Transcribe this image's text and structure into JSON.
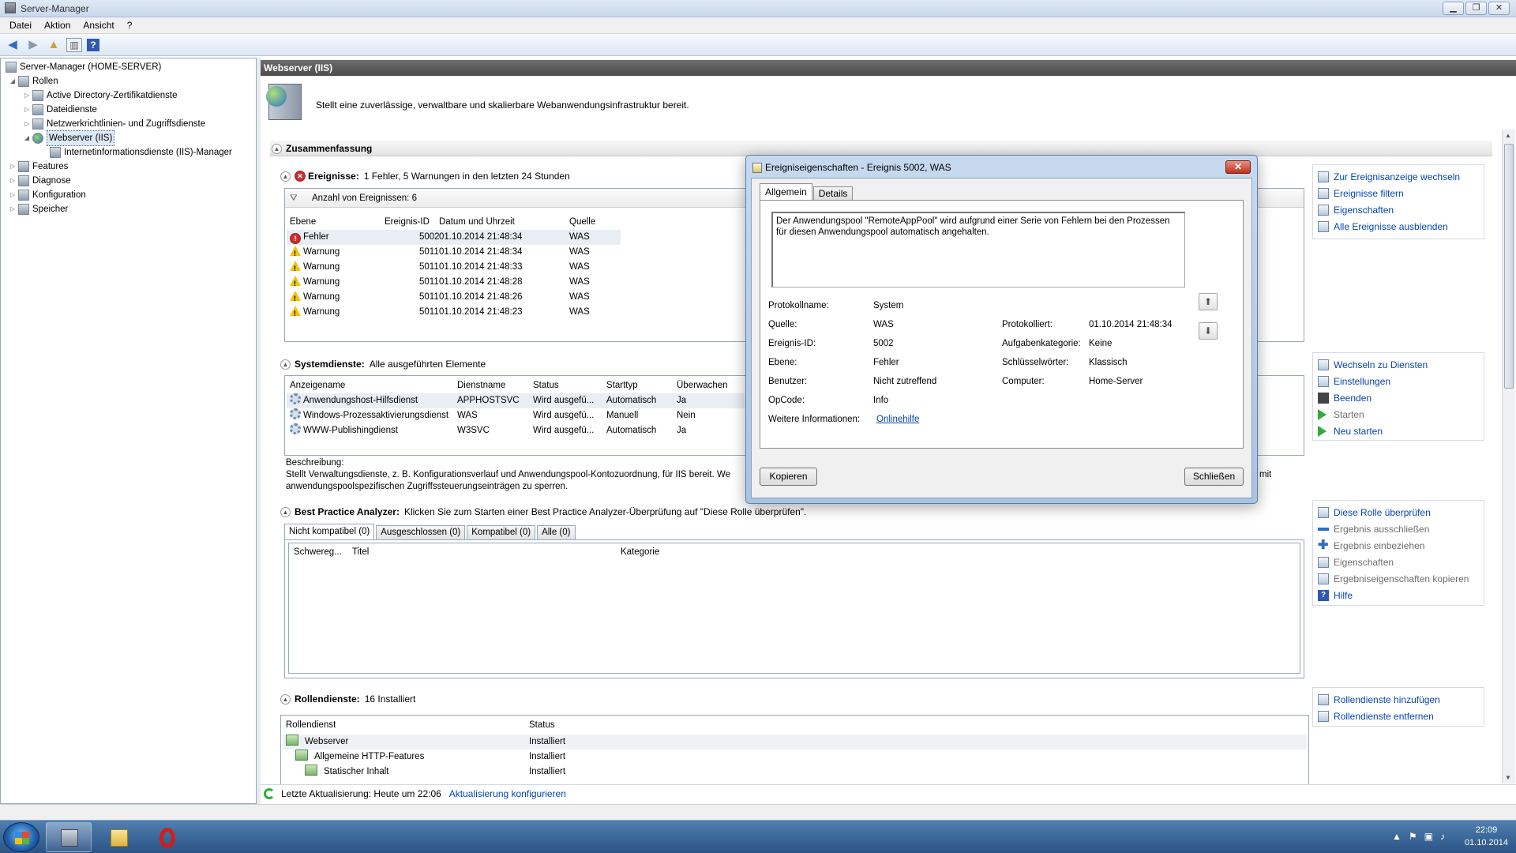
{
  "window": {
    "title": "Server-Manager"
  },
  "menu": [
    "Datei",
    "Aktion",
    "Ansicht",
    "?"
  ],
  "tree": {
    "root": "Server-Manager (HOME-SERVER)",
    "roles": "Rollen",
    "ad": "Active Directory-Zertifikatdienste",
    "files": "Dateidienste",
    "nps": "Netzwerkrichtlinien- und Zugriffsdienste",
    "iis": "Webserver (IIS)",
    "iismgr": "Internetinformationsdienste (IIS)-Manager",
    "features": "Features",
    "diag": "Diagnose",
    "config": "Konfiguration",
    "storage": "Speicher"
  },
  "main": {
    "header": "Webserver (IIS)",
    "description": "Stellt eine zuverlässige, verwaltbare und skalierbare Webanwendungsinfrastruktur bereit.",
    "summary": "Zusammenfassung"
  },
  "events": {
    "title": "Ereignisse:",
    "subtitle": "1 Fehler, 5 Warnungen in den letzten 24 Stunden",
    "filter_count": "Anzahl von Ereignissen: 6",
    "columns": [
      "Ebene",
      "Ereignis-ID",
      "Datum und Uhrzeit",
      "Quelle"
    ],
    "rows": [
      {
        "level": "Fehler",
        "id": "5002",
        "date": "01.10.2014 21:48:34",
        "source": "WAS"
      },
      {
        "level": "Warnung",
        "id": "5011",
        "date": "01.10.2014 21:48:34",
        "source": "WAS"
      },
      {
        "level": "Warnung",
        "id": "5011",
        "date": "01.10.2014 21:48:33",
        "source": "WAS"
      },
      {
        "level": "Warnung",
        "id": "5011",
        "date": "01.10.2014 21:48:28",
        "source": "WAS"
      },
      {
        "level": "Warnung",
        "id": "5011",
        "date": "01.10.2014 21:48:26",
        "source": "WAS"
      },
      {
        "level": "Warnung",
        "id": "5011",
        "date": "01.10.2014 21:48:23",
        "source": "WAS"
      }
    ],
    "actions": [
      "Zur Ereignisanzeige wechseln",
      "Ereignisse filtern",
      "Eigenschaften",
      "Alle Ereignisse ausblenden"
    ]
  },
  "services": {
    "title": "Systemdienste:",
    "subtitle": "Alle ausgeführten Elemente",
    "columns": [
      "Anzeigename",
      "Dienstname",
      "Status",
      "Starttyp",
      "Überwachen"
    ],
    "rows": [
      {
        "name": "Anwendungshost-Hilfsdienst",
        "svc": "APPHOSTSVC",
        "status": "Wird ausgefü...",
        "start": "Automatisch",
        "watch": "Ja"
      },
      {
        "name": "Windows-Prozessaktivierungsdienst",
        "svc": "WAS",
        "status": "Wird ausgefü...",
        "start": "Manuell",
        "watch": "Nein"
      },
      {
        "name": "WWW-Publishingdienst",
        "svc": "W3SVC",
        "status": "Wird ausgefü...",
        "start": "Automatisch",
        "watch": "Ja"
      }
    ],
    "desc_label": "Beschreibung:",
    "desc_line1": "Stellt Verwaltungsdienste, z. B. Konfigurationsverlauf und Anwendungspool-Kontozuordnung, für IIS bereit. We",
    "desc_line1_end": "mit",
    "desc_line2": "anwendungspoolspezifischen Zugriffssteuerungseinträgen zu sperren.",
    "actions": [
      "Wechseln zu Diensten",
      "Einstellungen",
      "Beenden",
      "Starten",
      "Neu starten"
    ]
  },
  "bpa": {
    "title": "Best Practice Analyzer:",
    "subtitle": "Klicken Sie zum Starten einer Best Practice Analyzer-Überprüfung auf \"Diese Rolle überprüfen\".",
    "tabs": [
      "Nicht kompatibel (0)",
      "Ausgeschlossen (0)",
      "Kompatibel (0)",
      "Alle (0)"
    ],
    "columns": [
      "Schwereg...",
      "Titel",
      "Kategorie"
    ],
    "actions": [
      "Diese Rolle überprüfen",
      "Ergebnis ausschließen",
      "Ergebnis einbeziehen",
      "Eigenschaften",
      "Ergebniseigenschaften kopieren",
      "Hilfe"
    ]
  },
  "roleservices": {
    "title": "Rollendienste:",
    "subtitle": "16 Installiert",
    "columns": [
      "Rollendienst",
      "Status"
    ],
    "rows": [
      {
        "name": "Webserver",
        "status": "Installiert"
      },
      {
        "name": "Allgemeine HTTP-Features",
        "status": "Installiert"
      },
      {
        "name": "Statischer Inhalt",
        "status": "Installiert"
      }
    ],
    "actions": [
      "Rollendienste hinzufügen",
      "Rollendienste entfernen"
    ]
  },
  "status": {
    "last_update": "Letzte Aktualisierung: Heute um 22:06",
    "configure": "Aktualisierung konfigurieren"
  },
  "dialog": {
    "title": "Ereigniseigenschaften - Ereignis 5002, WAS",
    "tabs": [
      "Allgemein",
      "Details"
    ],
    "message": "Der Anwendungspool \"RemoteAppPool\" wird aufgrund einer Serie von Fehlern bei den Prozessen für diesen Anwendungspool automatisch angehalten.",
    "log_name_label": "Protokollname:",
    "log_name": "System",
    "source_label": "Quelle:",
    "source": "WAS",
    "logged_label": "Protokolliert:",
    "logged": "01.10.2014 21:48:34",
    "event_id_label": "Ereignis-ID:",
    "event_id": "5002",
    "task_label": "Aufgabenkategorie:",
    "task": "Keine",
    "level_label": "Ebene:",
    "level": "Fehler",
    "keywords_label": "Schlüsselwörter:",
    "keywords": "Klassisch",
    "user_label": "Benutzer:",
    "user": "Nicht zutreffend",
    "computer_label": "Computer:",
    "computer": "Home-Server",
    "opcode_label": "OpCode:",
    "opcode": "Info",
    "more_label": "Weitere Informationen:",
    "more_link": "Onlinehilfe",
    "copy": "Kopieren",
    "close": "Schließen"
  },
  "clock": {
    "time": "22:09",
    "date": "01.10.2014"
  }
}
